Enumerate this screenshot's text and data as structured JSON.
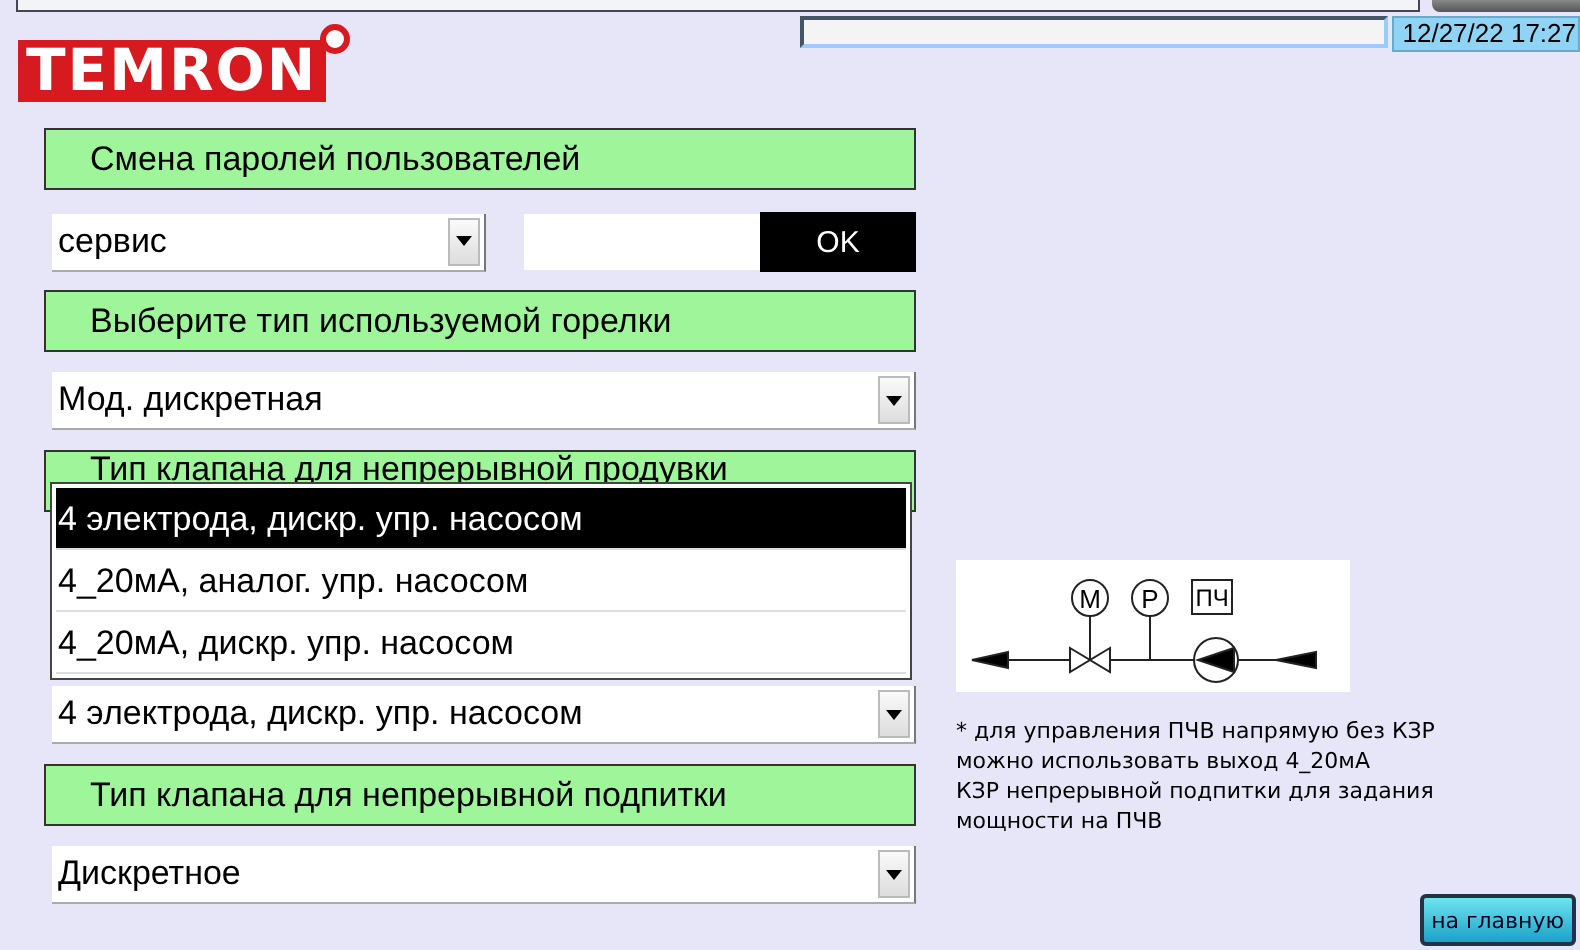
{
  "header": {
    "logo": "TEMRON",
    "datetime": "12/27/22 17:27"
  },
  "sections": [
    {
      "title": "Смена паролей пользователей",
      "kind": "password",
      "select": "сервис",
      "ok": "OK"
    },
    {
      "title": "Выберите тип используемой горелки",
      "kind": "select",
      "select": "Мод. дискретная"
    },
    {
      "title": "Тип клапана для непрерывной продувки",
      "kind": "open-select",
      "select": "4 электрода, дискр. упр. насосом",
      "options": [
        {
          "label": "4 электрода, дискр. упр. насосом",
          "selected": true
        },
        {
          "label": "4_20мА, аналог. упр. насосом",
          "selected": false
        },
        {
          "label": "4_20мА, дискр. упр. насосом",
          "selected": false
        }
      ]
    },
    {
      "title": "Тип клапана для непрерывной подпитки",
      "kind": "select",
      "select": "Дискретное"
    }
  ],
  "diagram": {
    "labels": [
      "M",
      "P",
      "ПЧ"
    ]
  },
  "note": "* для управления ПЧВ напрямую без КЗР\nможно использовать выход 4_20мА\nКЗР непрерывной подпитки для задания\nмощности на ПЧВ",
  "home_button": "на главную"
}
